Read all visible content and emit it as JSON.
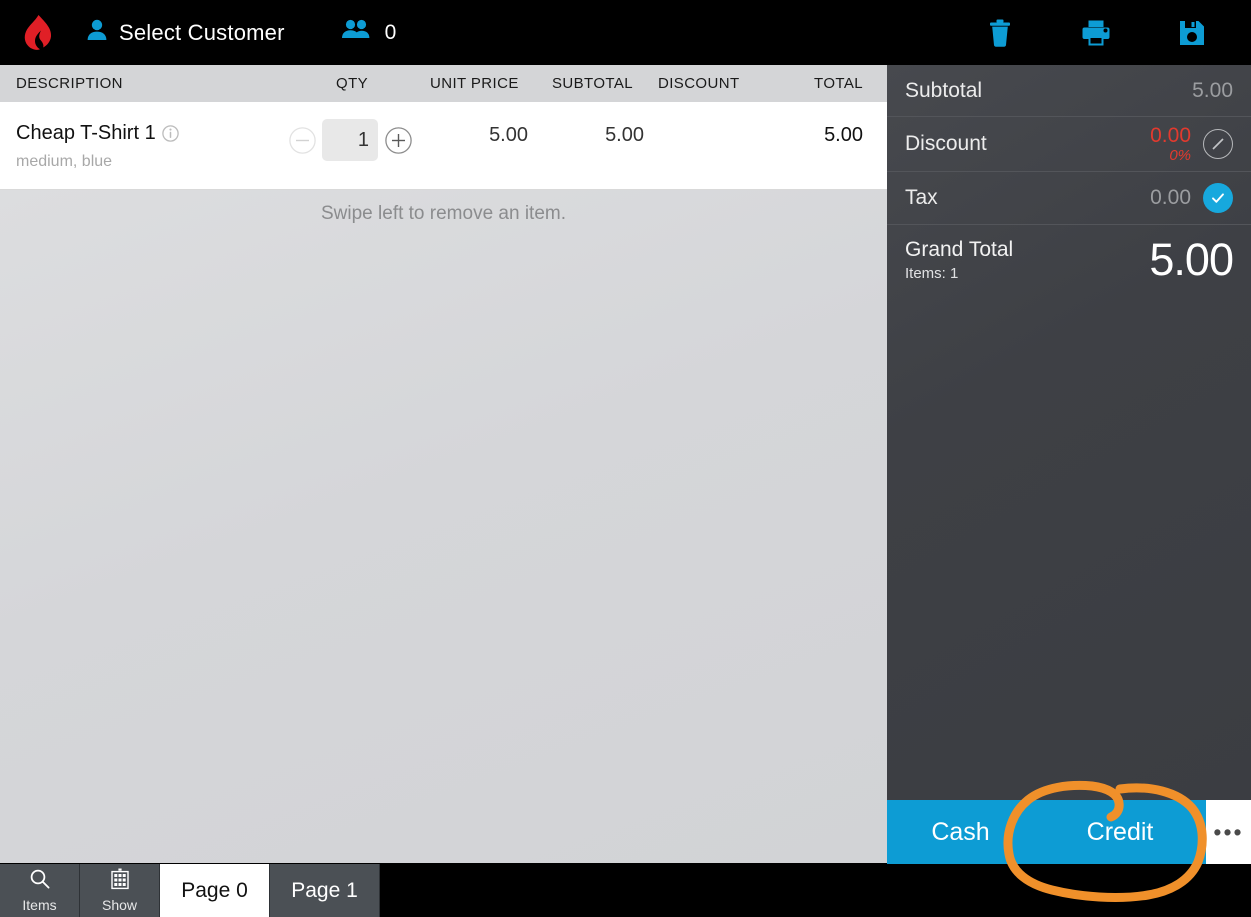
{
  "header": {
    "logo": "lightspeed-flame-logo",
    "customer_label": "Select Customer",
    "customer_icon": "person-icon",
    "people_icon": "people-group-icon",
    "people_count": "0",
    "actions": [
      {
        "name": "delete-sale-button",
        "icon": "trash-icon"
      },
      {
        "name": "print-button",
        "icon": "printer-icon"
      },
      {
        "name": "save-button",
        "icon": "floppy-save-icon"
      }
    ],
    "accent_blue": "#0d9cd4",
    "logo_red": "#e01f26"
  },
  "table": {
    "columns": {
      "description": "DESCRIPTION",
      "qty": "QTY",
      "unit_price": "UNIT PRICE",
      "subtotal": "SUBTOTAL",
      "discount": "DISCOUNT",
      "total": "TOTAL"
    },
    "rows": [
      {
        "name": "Cheap T-Shirt 1",
        "info_icon": "info-circle-icon",
        "variant": "medium, blue",
        "qty": "1",
        "minus": "−",
        "plus": "+",
        "unit_price": "5.00",
        "subtotal": "5.00",
        "discount": "",
        "total": "5.00"
      }
    ],
    "hint": "Swipe left to remove an item."
  },
  "summary": {
    "subtotal_label": "Subtotal",
    "subtotal_value": "5.00",
    "discount_label": "Discount",
    "discount_value": "0.00",
    "discount_percent": "0%",
    "discount_edit_icon": "pencil-circle-icon",
    "discount_color": "#e23a2e",
    "tax_label": "Tax",
    "tax_value": "0.00",
    "tax_check_icon": "check-circle-icon",
    "grand_total_label": "Grand Total",
    "items_label": "Items: 1",
    "grand_total_value": "5.00"
  },
  "payment": {
    "cash": "Cash",
    "credit": "Credit",
    "more": "•••",
    "button_color": "#0d9cd4"
  },
  "tabs": [
    {
      "label": "Items",
      "icon": "search-icon",
      "type": "icon",
      "active": false
    },
    {
      "label": "Show",
      "icon": "store-building-icon",
      "type": "icon",
      "active": false
    },
    {
      "label": "Page 0",
      "icon": "",
      "type": "page",
      "active": true
    },
    {
      "label": "Page 1",
      "icon": "",
      "type": "page",
      "active": false
    }
  ],
  "annotation": {
    "name": "handdrawn-highlight-circle",
    "target": "Credit",
    "color": "#f0902a"
  }
}
